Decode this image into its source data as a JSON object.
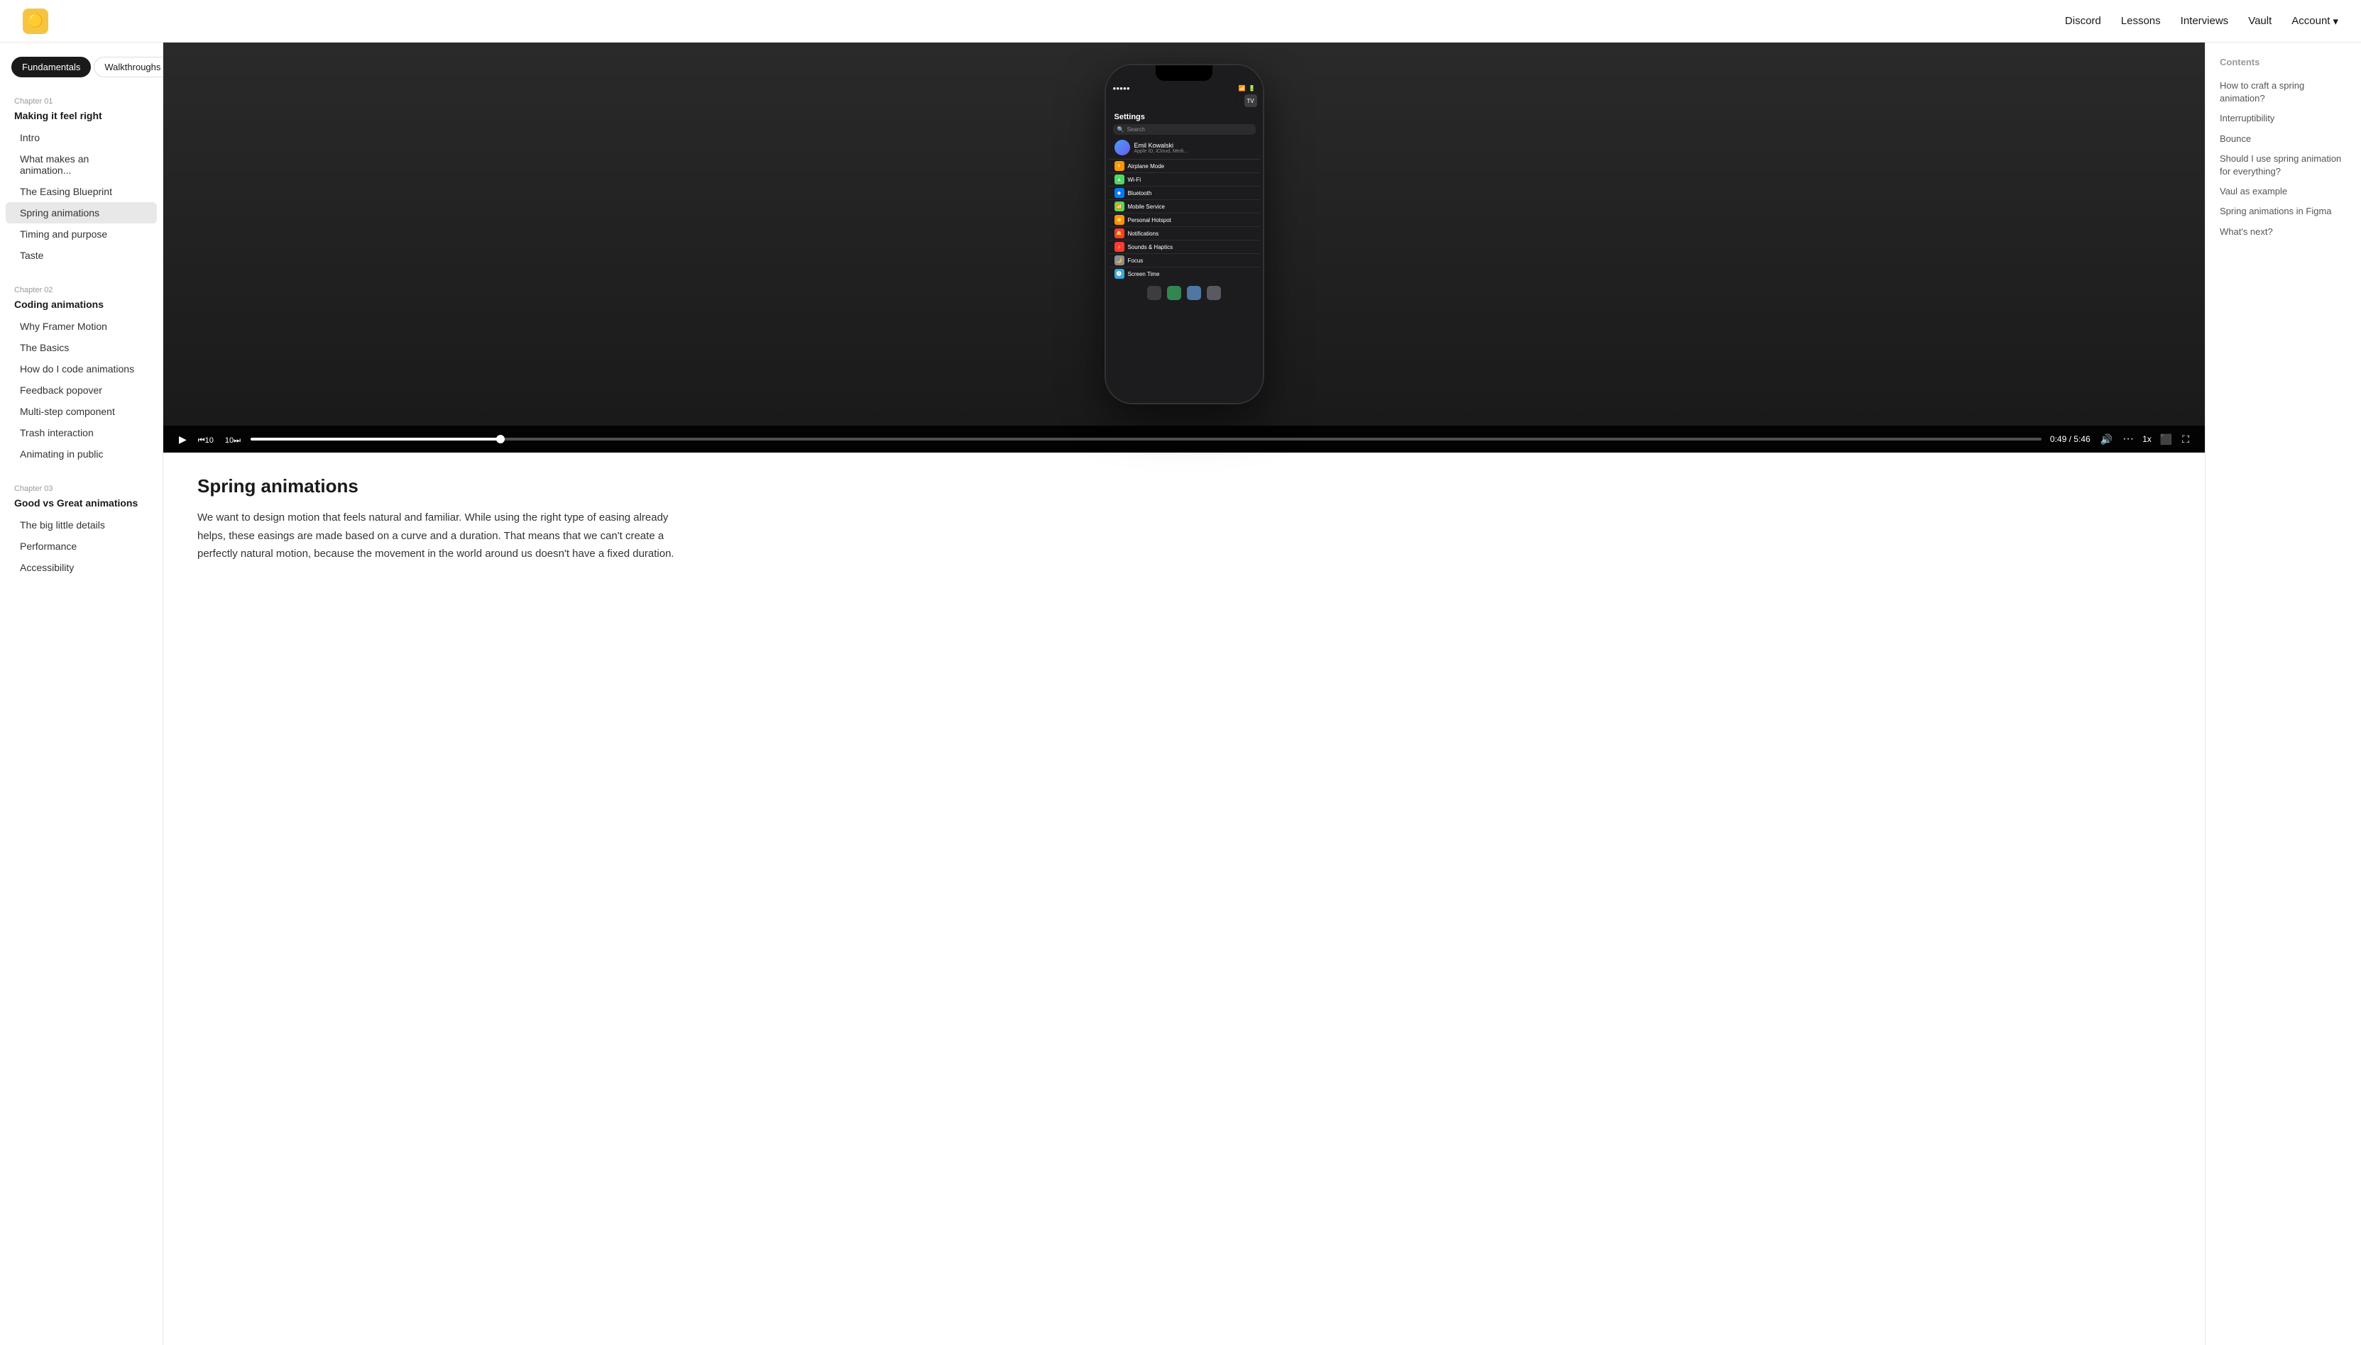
{
  "header": {
    "logo_emoji": "🟨",
    "nav": [
      {
        "label": "Discord",
        "id": "discord"
      },
      {
        "label": "Lessons",
        "id": "lessons"
      },
      {
        "label": "Interviews",
        "id": "interviews"
      },
      {
        "label": "Vault",
        "id": "vault"
      },
      {
        "label": "Account",
        "id": "account",
        "has_chevron": true
      }
    ]
  },
  "sidebar": {
    "tabs": [
      {
        "label": "Fundamentals",
        "active": true
      },
      {
        "label": "Walkthroughs",
        "active": false
      }
    ],
    "chapters": [
      {
        "chapter_label": "Chapter 01",
        "chapter_title": "Making it feel right",
        "items": [
          {
            "label": "Intro",
            "active": false,
            "id": "intro"
          },
          {
            "label": "What makes an animation...",
            "active": false,
            "id": "what-makes"
          },
          {
            "label": "The Easing Blueprint",
            "active": false,
            "id": "easing-blueprint"
          },
          {
            "label": "Spring animations",
            "active": true,
            "id": "spring-animations"
          },
          {
            "label": "Timing and purpose",
            "active": false,
            "id": "timing-purpose"
          },
          {
            "label": "Taste",
            "active": false,
            "id": "taste"
          }
        ]
      },
      {
        "chapter_label": "Chapter 02",
        "chapter_title": "Coding animations",
        "items": [
          {
            "label": "Why Framer Motion",
            "active": false,
            "id": "why-framer"
          },
          {
            "label": "The Basics",
            "active": false,
            "id": "the-basics"
          },
          {
            "label": "How do I code animations",
            "active": false,
            "id": "how-code"
          },
          {
            "label": "Feedback popover",
            "active": false,
            "id": "feedback-popover"
          },
          {
            "label": "Multi-step component",
            "active": false,
            "id": "multi-step"
          },
          {
            "label": "Trash interaction",
            "active": false,
            "id": "trash-interaction"
          },
          {
            "label": "Animating in public",
            "active": false,
            "id": "animating-public"
          }
        ]
      },
      {
        "chapter_label": "Chapter 03",
        "chapter_title": "Good vs Great animations",
        "items": [
          {
            "label": "The big little details",
            "active": false,
            "id": "big-little-details"
          },
          {
            "label": "Performance",
            "active": false,
            "id": "performance"
          },
          {
            "label": "Accessibility",
            "active": false,
            "id": "accessibility"
          }
        ]
      }
    ]
  },
  "video": {
    "current_time": "0:49",
    "total_time": "5:46",
    "progress_percent": 14,
    "speed": "1x"
  },
  "phone": {
    "settings_title": "Settings",
    "search_placeholder": "Search",
    "user_name": "Emil Kowalski",
    "user_sub": "Apple ID, iCloud, Medi...",
    "rows": [
      {
        "icon_color": "#ff9500",
        "icon": "✈",
        "label": "Airplane Mode"
      },
      {
        "icon_color": "#4cd964",
        "icon": "📶",
        "label": "Wi-Fi"
      },
      {
        "icon_color": "#007aff",
        "icon": "🔵",
        "label": "Bluetooth"
      },
      {
        "icon_color": "#4cd964",
        "icon": "📱",
        "label": "Mobile Service"
      },
      {
        "icon_color": "#ff9500",
        "icon": "🔥",
        "label": "Personal Hotspot"
      },
      {
        "icon_color": "#ff3b30",
        "icon": "🔔",
        "label": "Notifications"
      },
      {
        "icon_color": "#ff3b30",
        "icon": "🔊",
        "label": "Sounds & Haptics"
      },
      {
        "icon_color": "#8e8e93",
        "icon": "🌙",
        "label": "Focus"
      },
      {
        "icon_color": "#34aadc",
        "icon": "🕐",
        "label": "Screen Time"
      }
    ]
  },
  "article": {
    "title": "Spring animations",
    "body": "We want to design motion that feels natural and familiar. While using the right type of easing already helps, these easings are made based on a curve and a duration. That means that we can't create a perfectly natural motion, because the movement in the world around us doesn't have a fixed duration."
  },
  "contents": {
    "title": "Contents",
    "items": [
      {
        "label": "How to craft a spring animation?",
        "id": "craft-spring"
      },
      {
        "label": "Interruptibility",
        "id": "interruptibility"
      },
      {
        "label": "Bounce",
        "id": "bounce"
      },
      {
        "label": "Should I use spring animation for everything?",
        "id": "spring-everything"
      },
      {
        "label": "Vaul as example",
        "id": "vaul-example"
      },
      {
        "label": "Spring animations in Figma",
        "id": "spring-figma"
      },
      {
        "label": "What's next?",
        "id": "whats-next"
      }
    ]
  }
}
